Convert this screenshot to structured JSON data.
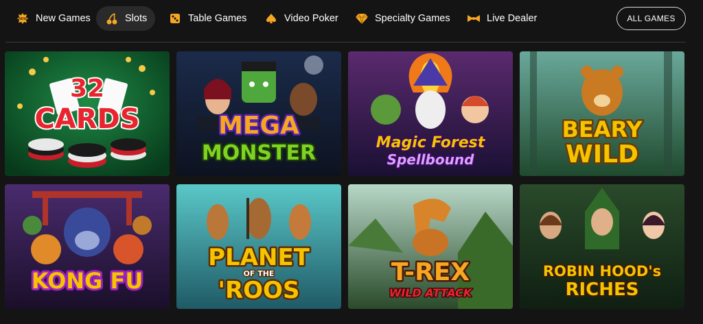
{
  "nav": {
    "items": [
      {
        "label": "New Games",
        "icon": "new-badge-icon"
      },
      {
        "label": "Slots",
        "icon": "cherries-icon",
        "active": true
      },
      {
        "label": "Table Games",
        "icon": "dice-icon"
      },
      {
        "label": "Video Poker",
        "icon": "spade-icon"
      },
      {
        "label": "Specialty Games",
        "icon": "diamond-icon"
      },
      {
        "label": "Live Dealer",
        "icon": "bowtie-icon"
      }
    ],
    "all_games_label": "ALL GAMES",
    "accent": "#f5a623"
  },
  "games": [
    {
      "title_line1": "32",
      "title_line2": "CARDS",
      "bg": "#0f5a2e"
    },
    {
      "title_line1": "MEGA",
      "title_line2": "MONSTER",
      "bg": "#1a2540"
    },
    {
      "title_line1": "Magic Forest",
      "title_line2": "Spellbound",
      "bg": "#3a1f55"
    },
    {
      "title_line1": "BEARY",
      "title_line2": "WILD",
      "bg": "#2f5a3a"
    },
    {
      "title_line1": "KONG FU",
      "title_line2": "",
      "bg": "#3b1d4f"
    },
    {
      "title_line1": "PLANET",
      "title_line2": "OF THE",
      "title_line3": "'ROOS",
      "bg": "#2f7f8a"
    },
    {
      "title_line1": "T-REX",
      "title_line2": "WILD ATTACK",
      "bg": "#3d5a3a"
    },
    {
      "title_line1": "ROBIN HOOD's",
      "title_line2": "RICHES",
      "bg": "#1d3a22"
    }
  ]
}
